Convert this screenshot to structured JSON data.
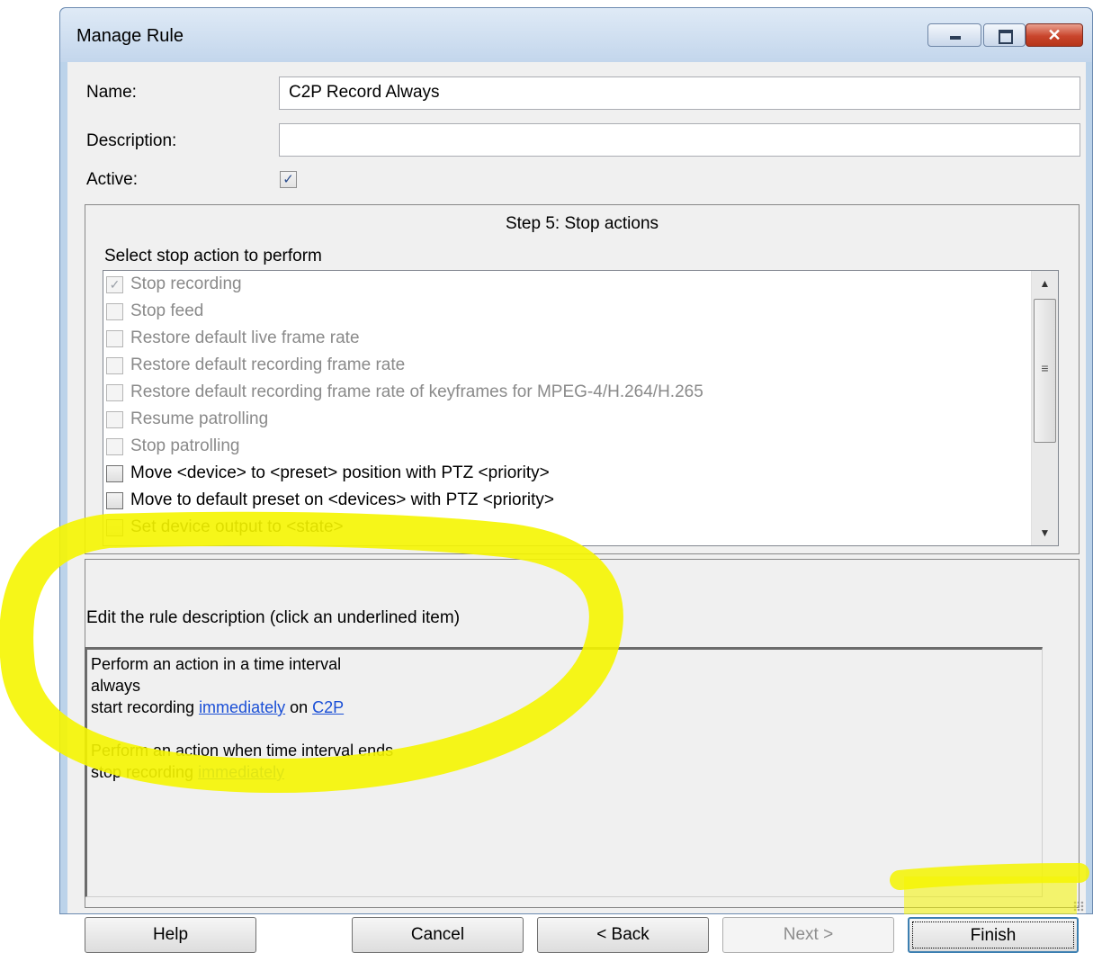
{
  "window": {
    "title": "Manage Rule",
    "close_glyph": "✕"
  },
  "form": {
    "name_label": "Name:",
    "name_value": "C2P Record Always",
    "description_label": "Description:",
    "description_value": "",
    "active_label": "Active:",
    "active_checked": true
  },
  "step": {
    "title": "Step 5: Stop actions",
    "select_label": "Select stop action to perform",
    "items": [
      {
        "label": "Stop recording",
        "checked": true,
        "enabled": false
      },
      {
        "label": "Stop feed",
        "checked": false,
        "enabled": false
      },
      {
        "label": "Restore default live frame rate",
        "checked": false,
        "enabled": false
      },
      {
        "label": "Restore default recording frame rate",
        "checked": false,
        "enabled": false
      },
      {
        "label": "Restore default recording frame rate of keyframes for MPEG-4/H.264/H.265",
        "checked": false,
        "enabled": false
      },
      {
        "label": "Resume patrolling",
        "checked": false,
        "enabled": false
      },
      {
        "label": "Stop patrolling",
        "checked": false,
        "enabled": false
      },
      {
        "label": "Move <device> to <preset> position with PTZ <priority>",
        "checked": false,
        "enabled": true
      },
      {
        "label": "Move to default preset on <devices> with PTZ <priority>",
        "checked": false,
        "enabled": true
      },
      {
        "label": "Set device output to <state>",
        "checked": false,
        "enabled": true
      }
    ]
  },
  "description": {
    "title": "Edit the rule description (click an underlined item)",
    "line1": "Perform an action in a time interval",
    "line2": "always",
    "line3_prefix": "start recording ",
    "line3_link1": "immediately",
    "line3_mid": " on ",
    "line3_link2": "C2P",
    "line4": "Perform an action when time interval ends",
    "line5_prefix": "stop recording ",
    "line5_link": "immediately"
  },
  "buttons": {
    "help": "Help",
    "cancel": "Cancel",
    "back": "< Back",
    "next": "Next >",
    "finish": "Finish"
  },
  "colors": {
    "highlight": "#f5f500",
    "link": "#1a4fd6",
    "close_button": "#c9452c"
  }
}
